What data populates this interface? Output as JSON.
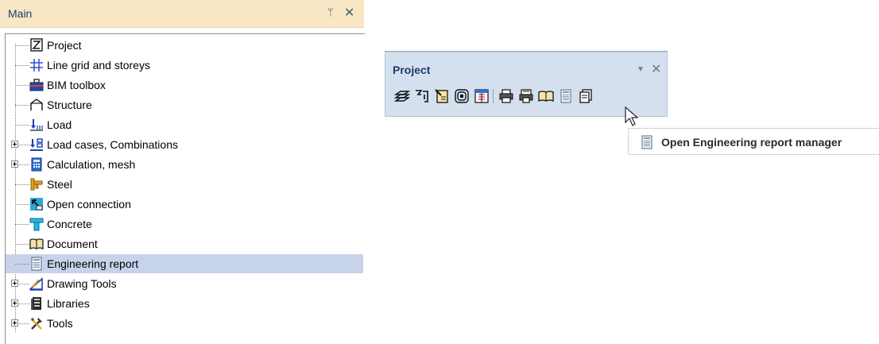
{
  "main_panel": {
    "title": "Main",
    "pin_glyph": "ᛘ",
    "close_glyph": "✕",
    "tree": [
      {
        "label": "Project",
        "icon": "project-icon",
        "expandable": false,
        "selected": false
      },
      {
        "label": "Line grid and storeys",
        "icon": "grid-icon",
        "expandable": false,
        "selected": false
      },
      {
        "label": "BIM toolbox",
        "icon": "toolbox-icon",
        "expandable": false,
        "selected": false
      },
      {
        "label": "Structure",
        "icon": "structure-icon",
        "expandable": false,
        "selected": false
      },
      {
        "label": "Load",
        "icon": "load-icon",
        "expandable": false,
        "selected": false
      },
      {
        "label": "Load cases, Combinations",
        "icon": "load-cases-icon",
        "expandable": true,
        "selected": false
      },
      {
        "label": "Calculation, mesh",
        "icon": "calculator-icon",
        "expandable": true,
        "selected": false
      },
      {
        "label": "Steel",
        "icon": "steel-icon",
        "expandable": false,
        "selected": false
      },
      {
        "label": "Open connection",
        "icon": "connection-icon",
        "expandable": false,
        "selected": false
      },
      {
        "label": "Concrete",
        "icon": "concrete-icon",
        "expandable": false,
        "selected": false
      },
      {
        "label": "Document",
        "icon": "document-icon",
        "expandable": false,
        "selected": false
      },
      {
        "label": "Engineering report",
        "icon": "report-icon",
        "expandable": false,
        "selected": true
      },
      {
        "label": "Drawing Tools",
        "icon": "drawing-tools-icon",
        "expandable": true,
        "selected": false
      },
      {
        "label": "Libraries",
        "icon": "libraries-icon",
        "expandable": true,
        "selected": false
      },
      {
        "label": "Tools",
        "icon": "tools-icon",
        "expandable": true,
        "selected": false
      }
    ]
  },
  "project_toolbar": {
    "title": "Project",
    "dropdown_glyph": "▼",
    "close_glyph": "✕",
    "buttons": [
      "layers-icon",
      "settings-icon",
      "properties-icon",
      "materials-icon",
      "grid-data-icon",
      "print-icon",
      "print-preview-icon",
      "document-icon",
      "report-icon",
      "copy-icon"
    ]
  },
  "tooltip": {
    "text": "Open Engineering report manager"
  },
  "colors": {
    "main_header_bg": "#f7e7c4",
    "toolbar_bg": "#d5e0ee",
    "selection_bg": "#c7d3ea",
    "title_text": "#1e3a6e"
  }
}
